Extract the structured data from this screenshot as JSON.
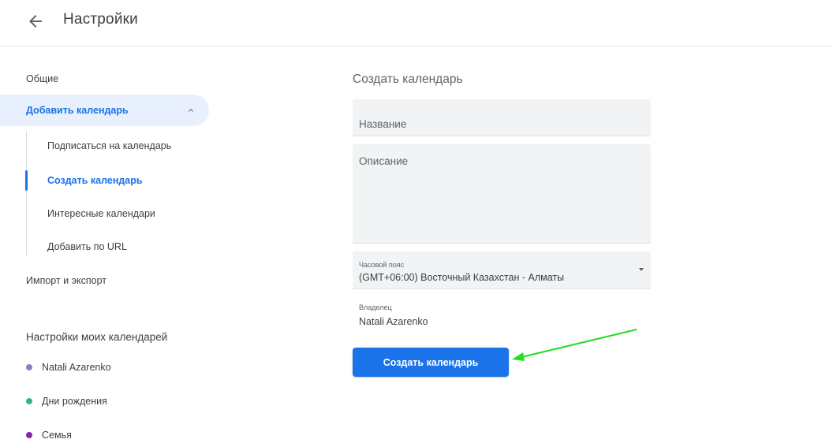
{
  "header": {
    "title": "Настройки",
    "back_icon": "arrow-left-icon"
  },
  "sidebar": {
    "general": "Общие",
    "add_calendar": "Добавить календарь",
    "sub_items": [
      "Подписаться на календарь",
      "Создать календарь",
      "Интересные календари",
      "Добавить по URL"
    ],
    "import_export": "Импорт и экспорт",
    "my_calendars_title": "Настройки моих календарей",
    "my_calendars": [
      {
        "name": "Natali Azarenko",
        "color": "#7986cb"
      },
      {
        "name": "Дни рождения",
        "color": "#33b679"
      },
      {
        "name": "Семья",
        "color": "#8e24aa"
      }
    ]
  },
  "main": {
    "heading": "Создать календарь",
    "name_placeholder": "Название",
    "description_placeholder": "Описание",
    "timezone_label": "Часовой пояс",
    "timezone_value": "(GMT+06:00) Восточный Казахстан - Алматы",
    "owner_label": "Владелец",
    "owner_value": "Natali Azarenko",
    "create_button": "Создать календарь"
  },
  "colors": {
    "accent": "#1a73e8",
    "selected_bg": "#e8f0fe",
    "field_bg": "#f1f3f4",
    "annotation_arrow": "#22dd22"
  }
}
